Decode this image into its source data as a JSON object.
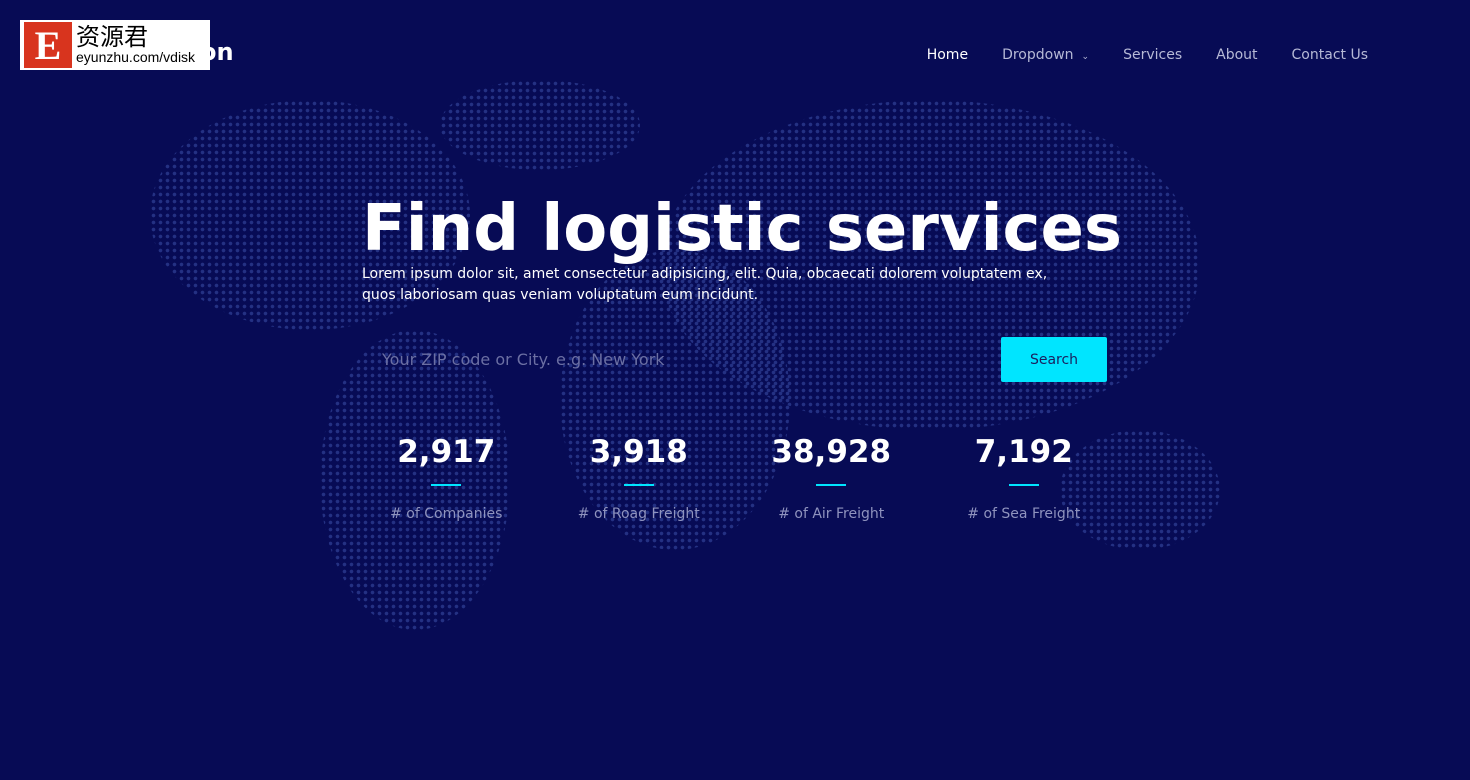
{
  "brand": {
    "visible_suffix": "on",
    "watermark": {
      "letter": "E",
      "cn": "资源君",
      "url": "eyunzhu.com/vdisk"
    }
  },
  "nav": {
    "items": [
      {
        "label": "Home",
        "active": true
      },
      {
        "label": "Dropdown",
        "has_dropdown": true
      },
      {
        "label": "Services"
      },
      {
        "label": "About"
      },
      {
        "label": "Contact Us"
      }
    ]
  },
  "hero": {
    "title": "Find logistic services",
    "lead": "Lorem ipsum dolor sit, amet consectetur adipisicing, elit. Quia, obcaecati dolorem voluptatem ex, quos laboriosam quas veniam voluptatum eum incidunt."
  },
  "search": {
    "placeholder": "Your ZIP code or City. e.g. New York",
    "value": "",
    "button": "Search"
  },
  "stats": [
    {
      "value": "2,917",
      "label": "# of Companies"
    },
    {
      "value": "3,918",
      "label": "# of Roag Freight"
    },
    {
      "value": "38,928",
      "label": "# of Air Freight"
    },
    {
      "value": "7,192",
      "label": "# of Sea Freight"
    }
  ],
  "colors": {
    "background": "#070b55",
    "accent": "#00e5ff"
  }
}
